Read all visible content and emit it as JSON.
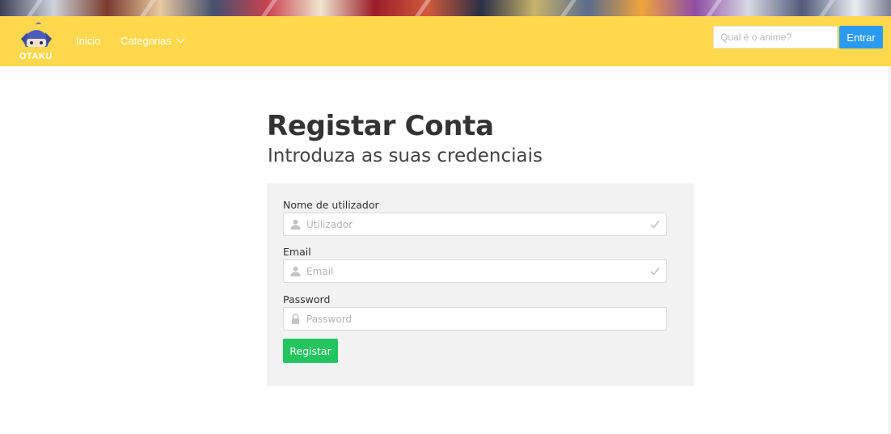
{
  "logo": {
    "text": "OTAKU"
  },
  "nav": {
    "home_label": "Inicio",
    "categories_label": "Categorias"
  },
  "search": {
    "placeholder": "Qual é o anime?",
    "value": "",
    "button_label": "Entrar"
  },
  "page": {
    "title": "Registar Conta",
    "subtitle": "Introduza as suas credenciais"
  },
  "form": {
    "fields": [
      {
        "label": "Nome de utilizador",
        "placeholder": "Utilizador",
        "value": "",
        "icon": "user-icon",
        "valid": true
      },
      {
        "label": "Email",
        "placeholder": "Email",
        "value": "",
        "icon": "user-icon",
        "valid": true
      },
      {
        "label": "Password",
        "placeholder": "Password",
        "value": "",
        "icon": "lock-icon",
        "valid": false
      }
    ],
    "submit_label": "Registar"
  },
  "colors": {
    "navbar": "#ffd84d",
    "search_button": "#2a9bf0",
    "submit_button": "#22c55e",
    "panel": "#f2f2f2"
  }
}
